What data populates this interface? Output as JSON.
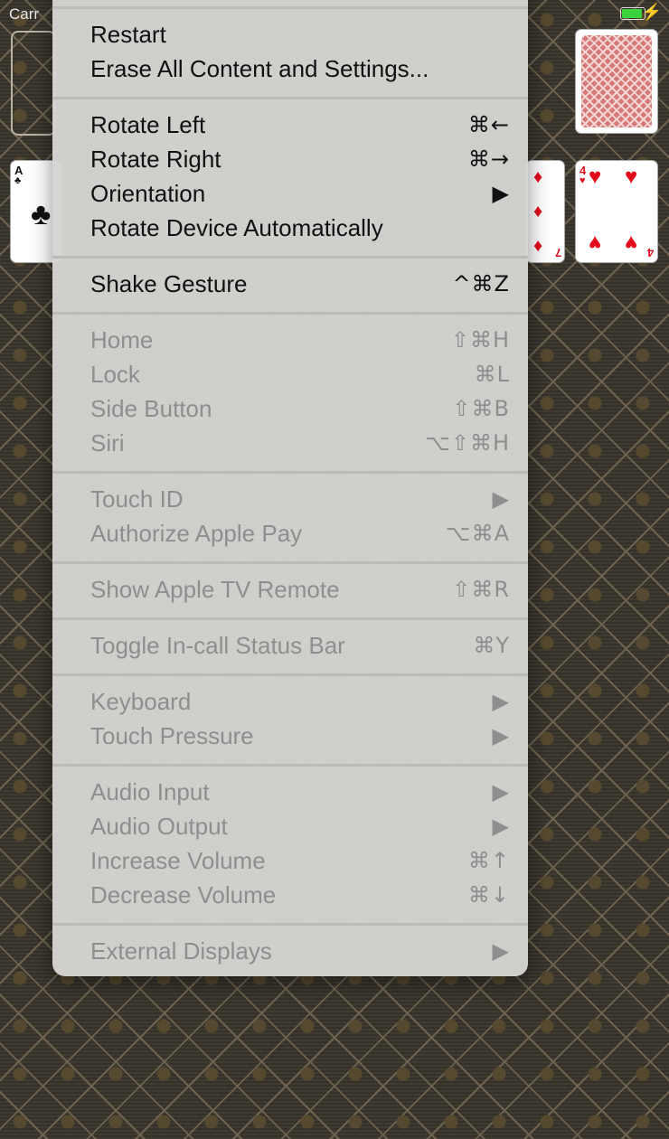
{
  "status_bar": {
    "carrier": "Carr"
  },
  "menu": {
    "items": [
      {
        "label": "Restart",
        "shortcut": "",
        "enabled": true
      },
      {
        "label": "Erase All Content and Settings...",
        "shortcut": "",
        "enabled": true
      },
      {
        "label": "Rotate Left",
        "shortcut": "⌘←",
        "enabled": true
      },
      {
        "label": "Rotate Right",
        "shortcut": "⌘→",
        "enabled": true
      },
      {
        "label": "Orientation",
        "shortcut": "▶",
        "enabled": true
      },
      {
        "label": "Rotate Device Automatically",
        "shortcut": "",
        "enabled": true
      },
      {
        "label": "Shake Gesture",
        "shortcut": "^⌘Z",
        "enabled": true
      },
      {
        "label": "Home",
        "shortcut": "⇧⌘H",
        "enabled": false
      },
      {
        "label": "Lock",
        "shortcut": "⌘L",
        "enabled": false
      },
      {
        "label": "Side Button",
        "shortcut": "⇧⌘B",
        "enabled": false
      },
      {
        "label": "Siri",
        "shortcut": "⌥⇧⌘H",
        "enabled": false
      },
      {
        "label": "Touch ID",
        "shortcut": "▶",
        "enabled": false
      },
      {
        "label": "Authorize Apple Pay",
        "shortcut": "⌥⌘A",
        "enabled": false
      },
      {
        "label": "Show Apple TV Remote",
        "shortcut": "⇧⌘R",
        "enabled": false
      },
      {
        "label": "Toggle In-call Status Bar",
        "shortcut": "⌘Y",
        "enabled": false
      },
      {
        "label": "Keyboard",
        "shortcut": "▶",
        "enabled": false
      },
      {
        "label": "Touch Pressure",
        "shortcut": "▶",
        "enabled": false
      },
      {
        "label": "Audio Input",
        "shortcut": "▶",
        "enabled": false
      },
      {
        "label": "Audio Output",
        "shortcut": "▶",
        "enabled": false
      },
      {
        "label": "Increase Volume",
        "shortcut": "⌘↑",
        "enabled": false
      },
      {
        "label": "Decrease Volume",
        "shortcut": "⌘↓",
        "enabled": false
      },
      {
        "label": "External Displays",
        "shortcut": "▶",
        "enabled": false
      }
    ]
  },
  "cards": {
    "ace": {
      "rank": "A",
      "suit": "♣"
    },
    "seven": {
      "rank": "7",
      "suit": "♦"
    },
    "four": {
      "rank": "4",
      "suit": "♥"
    }
  },
  "colors": {
    "battery": "#3bd33b",
    "card_red": "#e20d1c",
    "menu_bg": "#d6d4d2",
    "disabled_text": "#8e8e8e"
  }
}
